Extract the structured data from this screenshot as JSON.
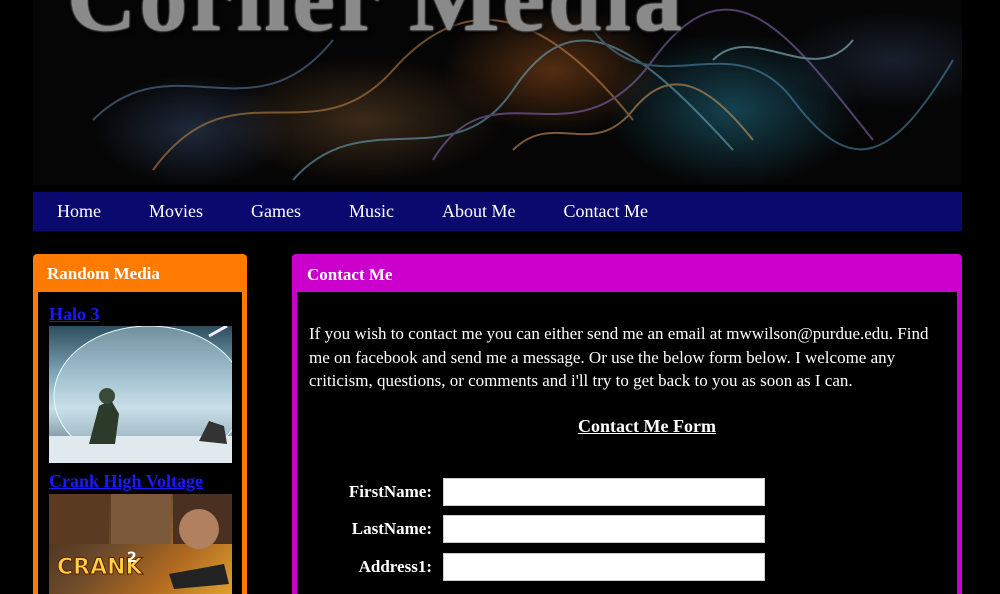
{
  "banner": {
    "title": "Corner Media"
  },
  "nav": {
    "items": [
      "Home",
      "Movies",
      "Games",
      "Music",
      "About Me",
      "Contact Me"
    ]
  },
  "sidebar": {
    "title": "Random Media",
    "items": [
      {
        "label": "Halo 3"
      },
      {
        "label": "Crank High Voltage"
      }
    ]
  },
  "main": {
    "title": "Contact Me",
    "intro": "If you wish to contact me you can either send me an email at mwwilson@purdue.edu. Find me on facebook and send me a message. Or use the below form below. I welcome any criticism, questions, or comments and i'll try to get back to you as soon as I can.",
    "form_title": "Contact Me Form",
    "fields": [
      {
        "label": "FirstName:",
        "value": ""
      },
      {
        "label": "LastName:",
        "value": ""
      },
      {
        "label": "Address1:",
        "value": ""
      }
    ]
  },
  "colors": {
    "nav_bg": "#0a0a6e",
    "sidebar_accent": "#ff7a00",
    "main_accent": "#cc00cc",
    "link": "#1a1aff"
  }
}
